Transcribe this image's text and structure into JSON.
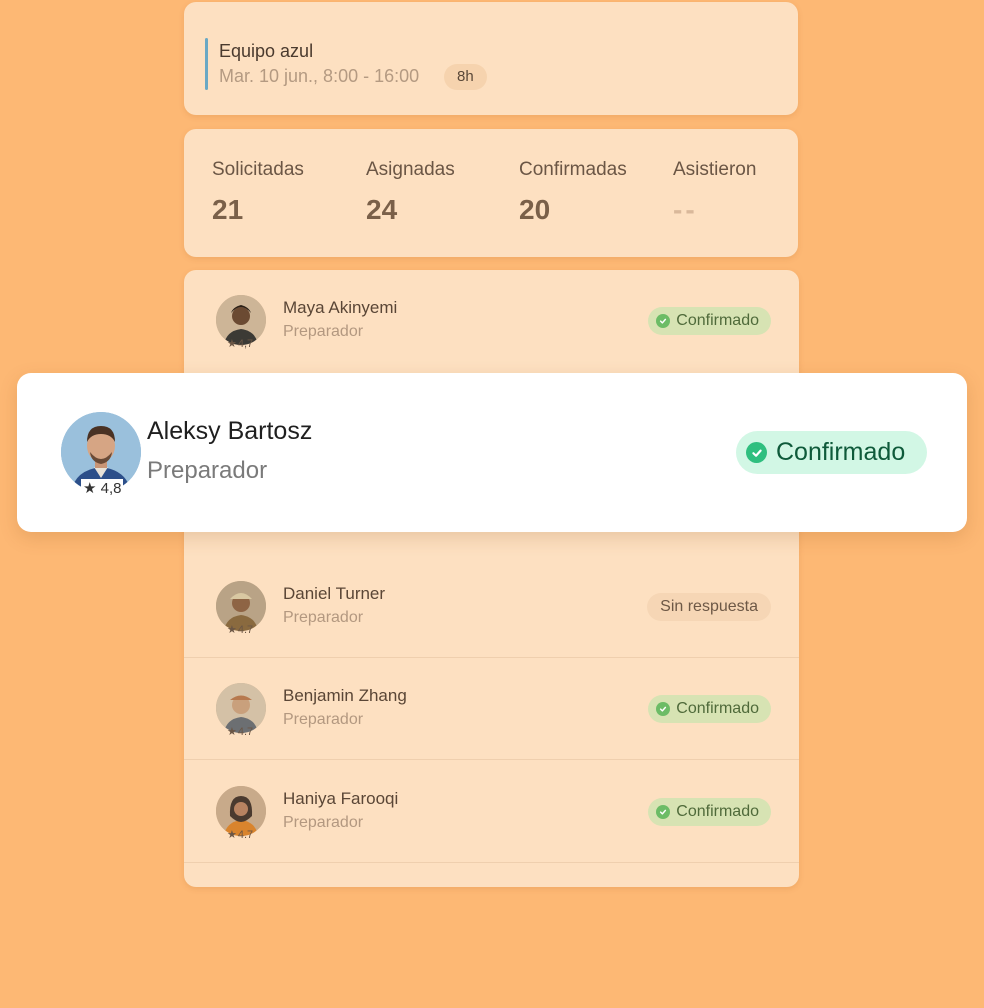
{
  "shift": {
    "team": "Equipo azul",
    "datetime": "Mar. 10 jun., 8:00 - 16:00",
    "hours": "8h",
    "accent_color": "#6aa8c4"
  },
  "stats": [
    {
      "label": "Solicitadas",
      "value": "21"
    },
    {
      "label": "Asignadas",
      "value": "24"
    },
    {
      "label": "Confirmadas",
      "value": "20"
    },
    {
      "label": "Asistieron",
      "value": "--"
    }
  ],
  "workers": [
    {
      "name": "Maya Akinyemi",
      "role": "Preparador",
      "rating": "4,7",
      "status": "Confirmado",
      "status_type": "confirmed"
    },
    {
      "name": "Daniel Turner",
      "role": "Preparador",
      "rating": "4.7",
      "status": "Sin respuesta",
      "status_type": "no-response"
    },
    {
      "name": "Benjamin Zhang",
      "role": "Preparador",
      "rating": "4.7",
      "status": "Confirmado",
      "status_type": "confirmed"
    },
    {
      "name": "Haniya Farooqi",
      "role": "Preparador",
      "rating": "4.7",
      "status": "Confirmado",
      "status_type": "confirmed"
    }
  ],
  "highlight": {
    "name": "Aleksy Bartosz",
    "role": "Preparador",
    "rating": "4,8",
    "status": "Confirmado"
  },
  "colors": {
    "background": "#fdb874",
    "card": "#fde0c1",
    "confirmed_badge": "#d7e3b3",
    "confirmed_check": "#6cbc66",
    "highlight_badge": "#d2f7e5",
    "highlight_check": "#2fbf7f"
  }
}
